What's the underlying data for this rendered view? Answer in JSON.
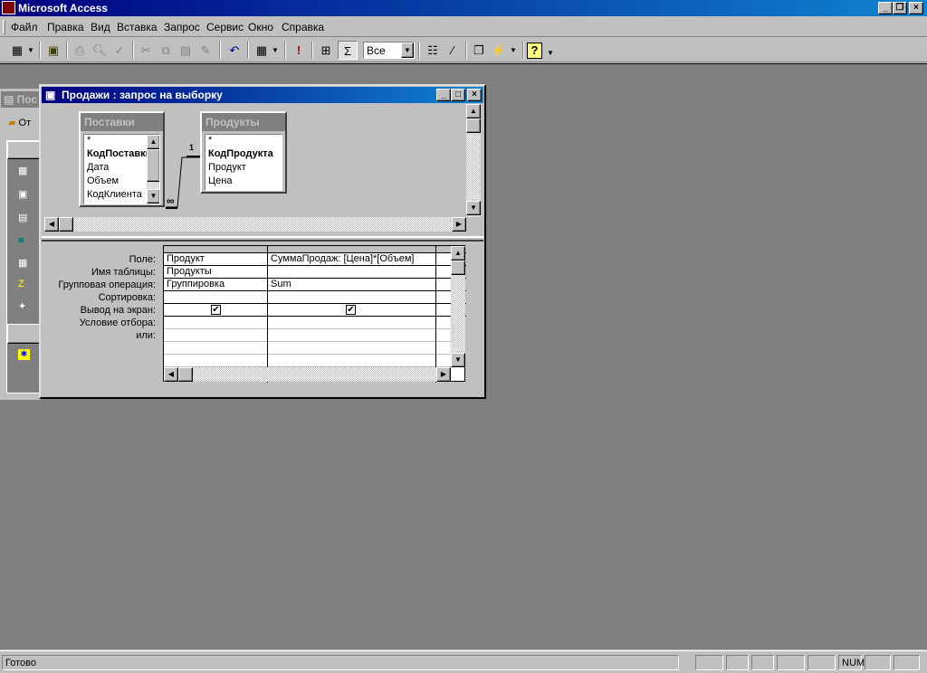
{
  "app": {
    "title": "Microsoft Access"
  },
  "menu": [
    "Файл",
    "Правка",
    "Вид",
    "Вставка",
    "Запрос",
    "Сервис",
    "Окно",
    "Справка"
  ],
  "toolbar": {
    "filter_value": "Все"
  },
  "db_window": {
    "title": "Пос",
    "open_label": "От"
  },
  "query_window": {
    "title": "Продажи : запрос на выборку",
    "tables": [
      {
        "name": "Поставки",
        "fields": [
          "*",
          "КодПоставки",
          "Дата",
          "Объем",
          "КодКлиента"
        ],
        "key": "КодПоставки"
      },
      {
        "name": "Продукты",
        "fields": [
          "*",
          "КодПродукта",
          "Продукт",
          "Цена"
        ],
        "key": "КодПродукта"
      }
    ],
    "relation": {
      "one": "1",
      "many": "∞"
    },
    "row_labels": [
      "Поле:",
      "Имя таблицы:",
      "Групповая операция:",
      "Сортировка:",
      "Вывод на экран:",
      "Условие отбора:",
      "или:"
    ],
    "columns": [
      {
        "field": "Продукт",
        "table": "Продукты",
        "total": "Группировка",
        "sort": "",
        "show": true
      },
      {
        "field": "СуммаПродаж: [Цена]*[Объем]",
        "table": "",
        "total": "Sum",
        "sort": "",
        "show": true
      }
    ]
  },
  "status": {
    "text": "Готово",
    "num": "NUM"
  }
}
